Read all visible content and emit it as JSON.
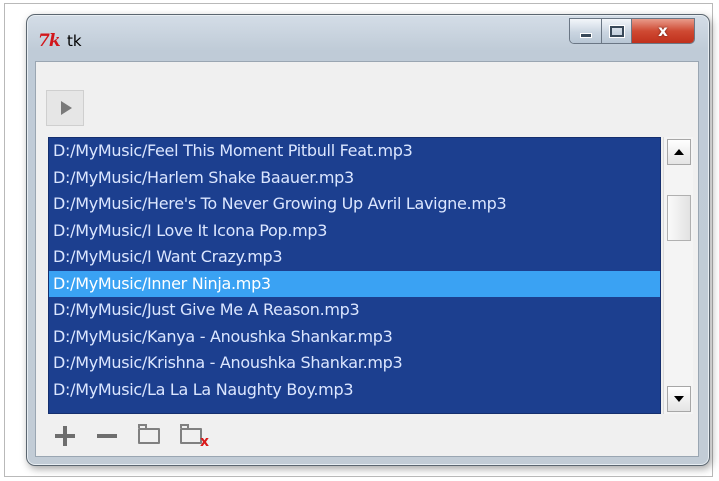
{
  "window": {
    "title": "tk",
    "app_icon_text": "7k",
    "close_symbol": "x"
  },
  "colors": {
    "list_background": "#1c3f8f",
    "list_selection": "#3aa2f3",
    "close_button": "#cf4a33",
    "delete_mark": "#d91b1b"
  },
  "icons": {
    "play": "play-icon",
    "add": "plus-icon",
    "remove": "minus-icon",
    "open_folder": "folder-icon",
    "delete_folder": "folder-delete-icon"
  },
  "playlist": {
    "items": [
      "D:/MyMusic/Feel This Moment Pitbull Feat.mp3",
      "D:/MyMusic/Harlem Shake Baauer.mp3",
      "D:/MyMusic/Here's To Never Growing Up Avril Lavigne.mp3",
      "D:/MyMusic/I Love It Icona Pop.mp3",
      "D:/MyMusic/I Want Crazy.mp3",
      "D:/MyMusic/Inner Ninja.mp3",
      "D:/MyMusic/Just Give Me A Reason.mp3",
      "D:/MyMusic/Kanya - Anoushka Shankar.mp3",
      "D:/MyMusic/Krishna - Anoushka Shankar.mp3",
      "D:/MyMusic/La La La Naughty Boy.mp3"
    ],
    "selected_index": 5
  }
}
